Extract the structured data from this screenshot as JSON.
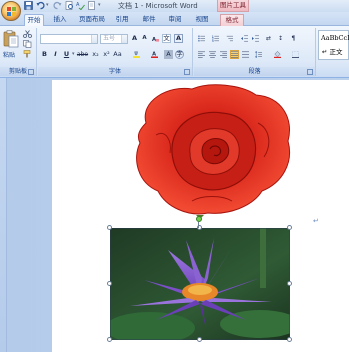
{
  "window": {
    "title": "文档 1 - Microsoft Word",
    "context_tab_group": "图片工具"
  },
  "tabs": [
    {
      "label": "开始",
      "active": true
    },
    {
      "label": "插入",
      "active": false
    },
    {
      "label": "页面布局",
      "active": false
    },
    {
      "label": "引用",
      "active": false
    },
    {
      "label": "邮件",
      "active": false
    },
    {
      "label": "审阅",
      "active": false
    },
    {
      "label": "视图",
      "active": false
    },
    {
      "label": "格式",
      "active": false
    }
  ],
  "ribbon": {
    "clipboard": {
      "label": "剪贴板",
      "paste_label": "粘贴"
    },
    "font": {
      "label": "字体",
      "font_name_placeholder": "",
      "font_size_placeholder": "五号"
    },
    "paragraph": {
      "label": "段落"
    },
    "styles": {
      "sample_text": "AaBbCcDd",
      "style_name": "↵ 正文"
    }
  },
  "document": {
    "paragraph_mark": "↵",
    "images": [
      {
        "name": "rose",
        "selected": false
      },
      {
        "name": "water-lily",
        "selected": true
      }
    ]
  },
  "colors": {
    "ribbon_text": "#15428b",
    "highlight_yellow": "#f9c95b",
    "font_color_red": "#e0201c",
    "rose_red": "#d8261b",
    "lily_purple": "#7b4fc8"
  }
}
